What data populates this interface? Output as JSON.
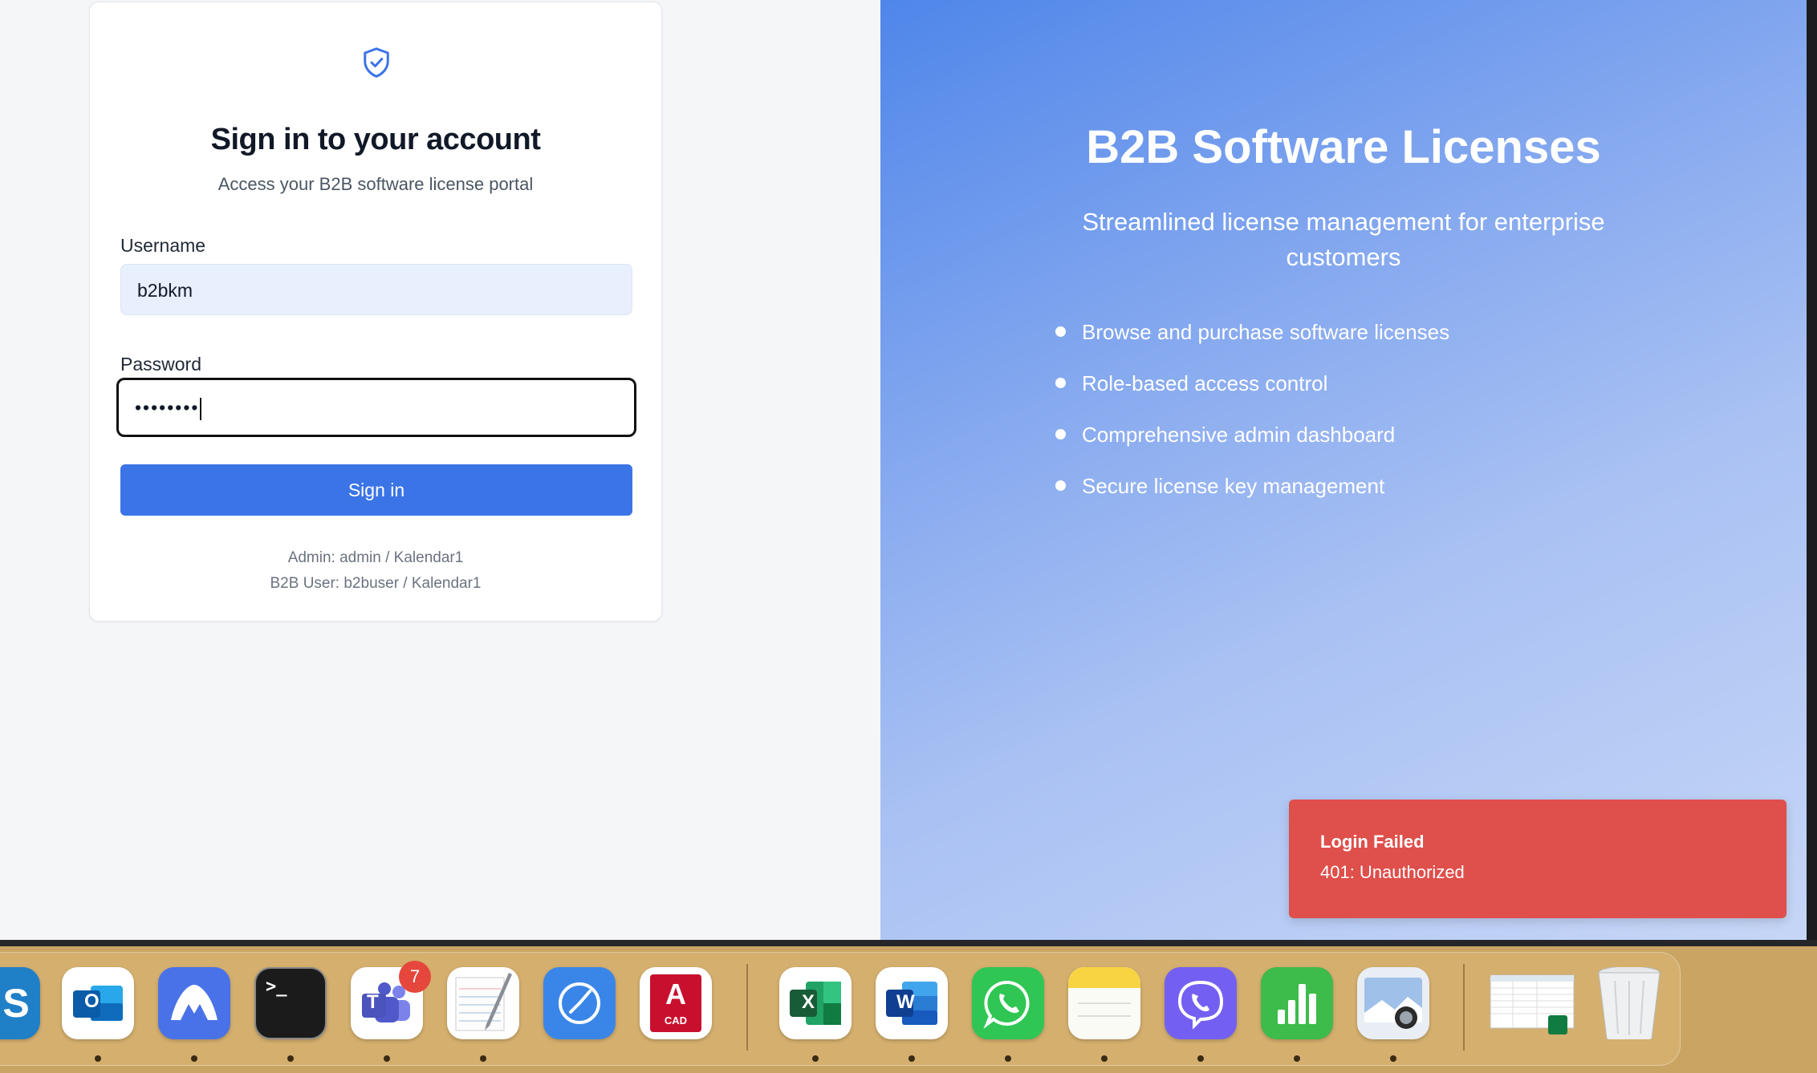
{
  "login": {
    "title": "Sign in to your account",
    "subtitle": "Access your B2B software license portal",
    "username_label": "Username",
    "username_value": "b2bkm",
    "password_label": "Password",
    "password_value": "••••••••",
    "submit_label": "Sign in",
    "hint_admin": "Admin: admin / Kalendar1",
    "hint_user": "B2B User: b2buser / Kalendar1"
  },
  "promo": {
    "title": "B2B Software Licenses",
    "subtitle": "Streamlined license management for enterprise customers",
    "features": [
      "Browse and purchase software licenses",
      "Role-based access control",
      "Comprehensive admin dashboard",
      "Secure license key management"
    ]
  },
  "toast": {
    "title": "Login Failed",
    "message": "401: Unauthorized"
  },
  "dock": {
    "teams_badge": "7",
    "excel_letter": "X",
    "word_letter": "W",
    "outlook_letter": "O",
    "teams_letter": "T",
    "autocad_letter": "A",
    "autocad_sub": "CAD",
    "terminal_prompt": ">_"
  },
  "colors": {
    "primary": "#3b74e6",
    "error": "#df4f4b",
    "heading": "#111827"
  }
}
